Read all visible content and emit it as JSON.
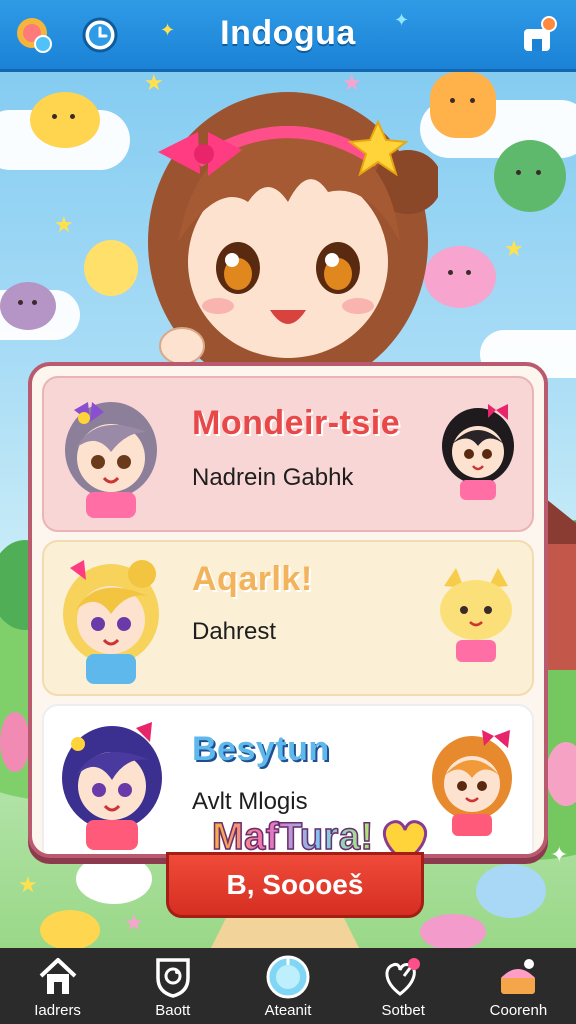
{
  "app": {
    "title": "Indogua"
  },
  "topbar": {
    "left_icons": [
      "profile-badge-icon",
      "clock-icon"
    ],
    "right_icon": "shop-icon"
  },
  "content_list": [
    {
      "title": "Mondeir-tsie",
      "subtitle": "Nadrein Gabhk",
      "left_avatar": "grey-haired-girl-avatar",
      "right_avatar": "black-haired-girl-avatar"
    },
    {
      "title": "Aqarlk!",
      "subtitle": "Dahrest",
      "left_avatar": "blonde-girl-avatar",
      "right_avatar": "yellow-cat-avatar"
    },
    {
      "title": "Besytun",
      "subtitle": "Avlt Mlogis",
      "left_avatar": "purple-haired-girl-avatar",
      "right_avatar": "orange-haired-girl-avatar",
      "banner": "MafTura!"
    }
  ],
  "action_button": {
    "label": "B, Soooeš"
  },
  "bottom_nav": [
    {
      "label": "Iadrers",
      "icon": "home-icon"
    },
    {
      "label": "Baott",
      "icon": "shield-icon"
    },
    {
      "label": "Ateanit",
      "icon": "globe-icon"
    },
    {
      "label": "Sotbet",
      "icon": "heart-pin-icon"
    },
    {
      "label": "Coorenh",
      "icon": "treasure-icon"
    }
  ],
  "colors": {
    "topbar": "#1b82d6",
    "panel_border": "#b95a6e",
    "action_button": "#d62f22",
    "nav_bg": "#2b2b2b"
  }
}
